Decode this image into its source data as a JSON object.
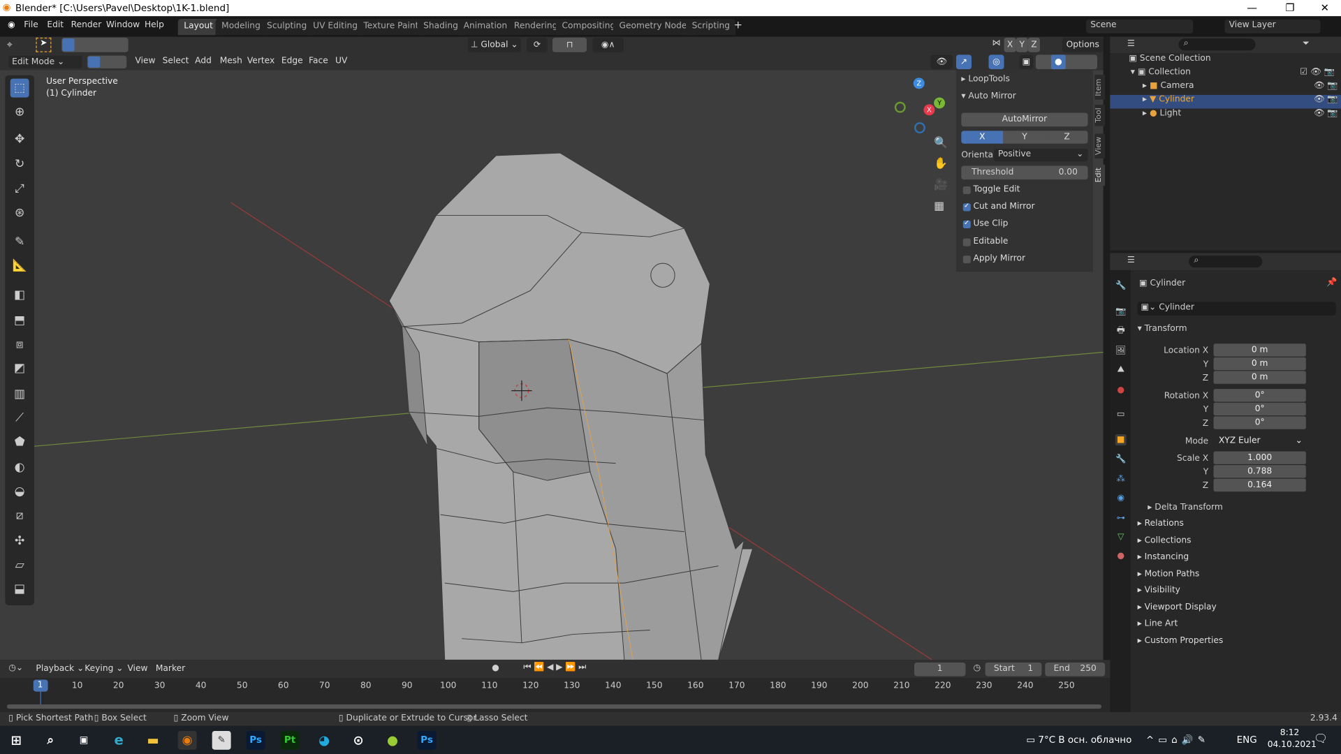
{
  "window": {
    "title": "Blender* [C:\\Users\\Pavel\\Desktop\\1K-1.blend]"
  },
  "menu": [
    "File",
    "Edit",
    "Render",
    "Window",
    "Help"
  ],
  "workspaces": [
    "Layout",
    "Modeling",
    "Sculpting",
    "UV Editing",
    "Texture Paint",
    "Shading",
    "Animation",
    "Rendering",
    "Compositing",
    "Geometry Nodes",
    "Scripting"
  ],
  "active_workspace": "Layout",
  "scene": "Scene",
  "view_layer": "View Layer",
  "tool_header": {
    "orientation": "Global",
    "axes": [
      "X",
      "Y",
      "Z"
    ],
    "options": "Options"
  },
  "view_header": {
    "mode": "Edit Mode",
    "menus": [
      "View",
      "Select",
      "Add",
      "Mesh",
      "Vertex",
      "Edge",
      "Face",
      "UV"
    ]
  },
  "viewport": {
    "perspective": "User Perspective",
    "object": "(1) Cylinder",
    "gizmo_axes": [
      "X",
      "Y",
      "Z"
    ]
  },
  "npanel": {
    "tabs": [
      "Item",
      "Tool",
      "View",
      "Edit"
    ],
    "sections": [
      "LoopTools",
      "Auto Mirror"
    ],
    "automirror_button": "AutoMirror",
    "axes": [
      "X",
      "Y",
      "Z"
    ],
    "active_axis": "X",
    "orientation_label": "Orienta...",
    "orientation_value": "Positive",
    "threshold_label": "Threshold",
    "threshold_value": "0.00",
    "checkboxes": [
      {
        "label": "Toggle Edit",
        "checked": false
      },
      {
        "label": "Cut and Mirror",
        "checked": true
      },
      {
        "label": "Use Clip",
        "checked": true
      },
      {
        "label": "Editable",
        "checked": false
      },
      {
        "label": "Apply Mirror",
        "checked": false
      }
    ]
  },
  "outliner": {
    "root": "Scene Collection",
    "collection": "Collection",
    "items": [
      {
        "name": "Camera",
        "selected": false
      },
      {
        "name": "Cylinder",
        "selected": true
      },
      {
        "name": "Light",
        "selected": false
      }
    ]
  },
  "properties": {
    "object": "Cylinder",
    "datablock": "Cylinder",
    "transform_label": "Transform",
    "location": {
      "label": "Location X",
      "x": "0 m",
      "y": "0 m",
      "z": "0 m"
    },
    "rotation": {
      "label": "Rotation X",
      "x": "0°",
      "y": "0°",
      "z": "0°"
    },
    "mode_label": "Mode",
    "mode": "XYZ Euler",
    "scale": {
      "label": "Scale X",
      "x": "1.000",
      "y": "0.788",
      "z": "0.164"
    },
    "axis_y": "Y",
    "axis_z": "Z",
    "delta": "Delta Transform",
    "panels": [
      "Relations",
      "Collections",
      "Instancing",
      "Motion Paths",
      "Visibility",
      "Viewport Display",
      "Line Art",
      "Custom Properties"
    ]
  },
  "timeline": {
    "menus": [
      "Playback",
      "Keying",
      "View",
      "Marker"
    ],
    "current_frame": "1",
    "start_label": "Start",
    "start": "1",
    "end_label": "End",
    "end": "250",
    "ticks": [
      "1",
      "10",
      "20",
      "30",
      "40",
      "50",
      "60",
      "70",
      "80",
      "90",
      "100",
      "110",
      "120",
      "130",
      "140",
      "150",
      "160",
      "170",
      "180",
      "190",
      "200",
      "210",
      "220",
      "230",
      "240",
      "250"
    ]
  },
  "statusbar": {
    "items": [
      "Pick Shortest Path",
      "Box Select",
      "Zoom View",
      "Duplicate or Extrude to Cursor",
      "Lasso Select"
    ],
    "version": "2.93.4"
  },
  "taskbar": {
    "weather": "7°C  В осн. облачно",
    "lang": "ENG",
    "time": "8:12",
    "date": "04.10.2021"
  },
  "colors": {
    "accent": "#4772b3",
    "selected_object": "#f5a623",
    "x_axis": "#e8394d",
    "y_axis": "#7ab735",
    "z_axis": "#3b8ce0"
  }
}
